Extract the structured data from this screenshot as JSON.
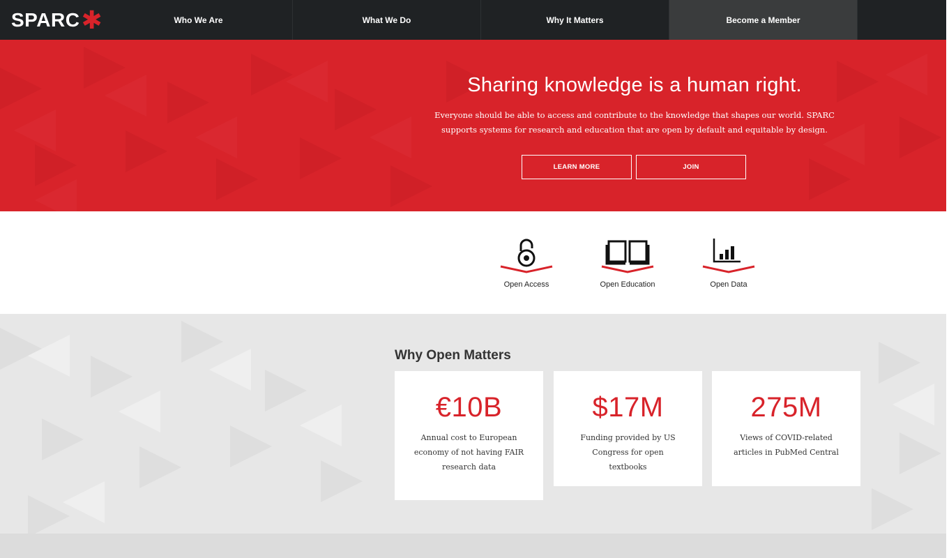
{
  "nav": {
    "logo_text": "SPARC",
    "logo_mark": "✱",
    "items": [
      {
        "label": "Who We Are"
      },
      {
        "label": "What We Do"
      },
      {
        "label": "Why It Matters"
      },
      {
        "label": "Become a Member"
      }
    ]
  },
  "hero": {
    "title": "Sharing knowledge is a human right.",
    "text": "Everyone should be able to access and contribute to the knowledge that shapes our world. SPARC supports systems for research and education that are open by default and equitable by design.",
    "buttons": {
      "learn_more": "LEARN MORE",
      "join": "JOIN"
    }
  },
  "icons": [
    {
      "label": "Open Access",
      "icon": "open-lock-icon"
    },
    {
      "label": "Open Education",
      "icon": "open-book-icon"
    },
    {
      "label": "Open Data",
      "icon": "bar-chart-icon"
    }
  ],
  "stats": {
    "title": "Why Open Matters",
    "cards": [
      {
        "value": "€10B",
        "desc": "Annual cost to European economy of not having FAIR research data"
      },
      {
        "value": "$17M",
        "desc": "Funding provided by US Congress for open textbooks"
      },
      {
        "value": "275M",
        "desc": "Views of COVID-related articles in PubMed Central"
      }
    ]
  },
  "colors": {
    "brand_red": "#d8232a",
    "nav_dark": "#1f2224",
    "stats_bg": "#e7e7e7"
  }
}
